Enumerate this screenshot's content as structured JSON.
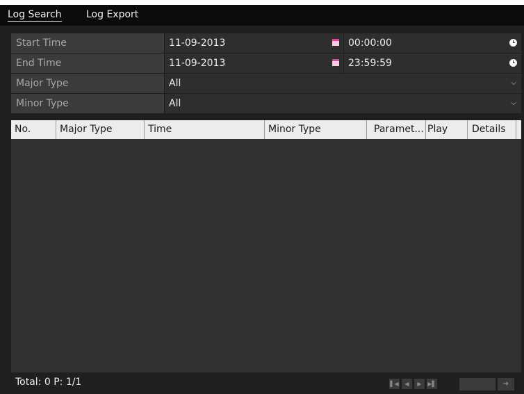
{
  "tabs": [
    {
      "label": "Log Search",
      "active": true
    },
    {
      "label": "Log Export",
      "active": false
    }
  ],
  "filters": {
    "start_time": {
      "label": "Start Time",
      "date": "11-09-2013",
      "time": "00:00:00"
    },
    "end_time": {
      "label": "End Time",
      "date": "11-09-2013",
      "time": "23:59:59"
    },
    "major_type": {
      "label": "Major Type",
      "value": "All"
    },
    "minor_type": {
      "label": "Minor Type",
      "value": "All"
    }
  },
  "table": {
    "columns": [
      "No.",
      "Major Type",
      "Time",
      "Minor Type",
      "Paramet...",
      "Play",
      "Details"
    ],
    "rows": []
  },
  "footer": {
    "status": "Total: 0  P: 1/1",
    "page_input": ""
  },
  "icons": {
    "calendar": "calendar-icon",
    "clock": "clock-icon",
    "dropdown": "chevron-down-icon",
    "first": "first-page-icon",
    "prev": "prev-page-icon",
    "next": "next-page-icon",
    "last": "last-page-icon",
    "go": "go-arrow-icon"
  },
  "colors": {
    "background": "#1f1f1f",
    "tabbar": "#0b0b0b",
    "label_bg": "#3b3b3b",
    "field_bg": "#2e2e2e",
    "header_bg": "#e7e7e7",
    "calendar_accent": "#e0449a"
  }
}
